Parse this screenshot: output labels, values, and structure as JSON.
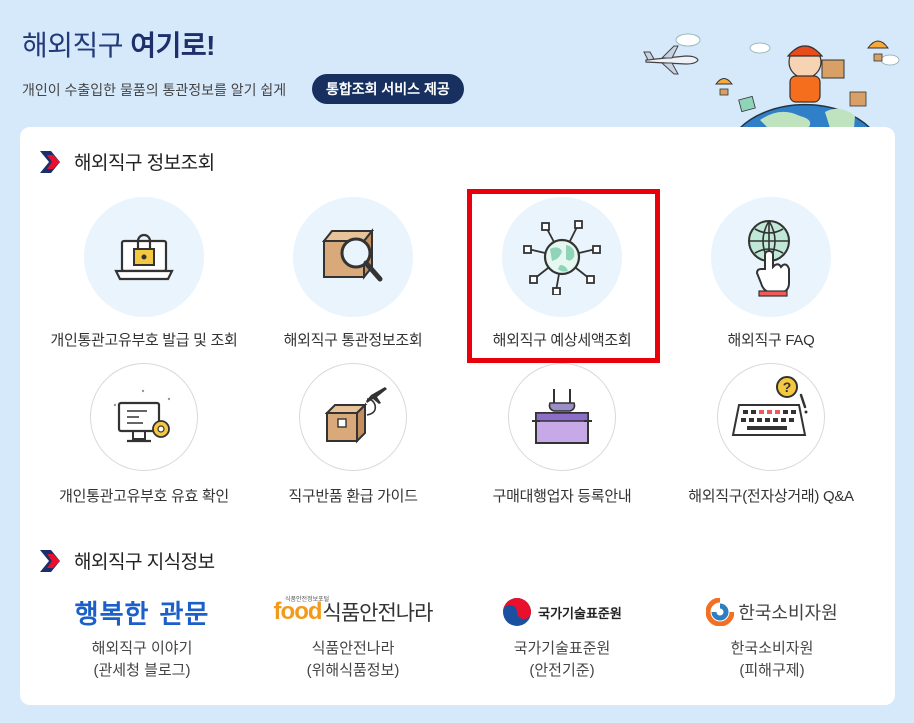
{
  "hero": {
    "title_plain": "해외직구 ",
    "title_bold": "여기로!",
    "subtitle": "개인이 수출입한 물품의 통관정보를 알기 쉽게",
    "badge": "통합조회 서비스 제공"
  },
  "section_info": {
    "title": "해외직구 정보조회"
  },
  "services": [
    {
      "label": "개인통관고유부호 발급 및 조회",
      "icon": "laptop-lock-icon"
    },
    {
      "label": "해외직구 통관정보조회",
      "icon": "box-magnifier-icon"
    },
    {
      "label": "해외직구 예상세액조회",
      "icon": "globe-network-icon"
    },
    {
      "label": "해외직구 FAQ",
      "icon": "globe-hand-icon"
    },
    {
      "label": "개인통관고유부호 유효 확인",
      "icon": "monitor-gear-icon"
    },
    {
      "label": "직구반품 환급 가이드",
      "icon": "box-airplane-icon"
    },
    {
      "label": "구매대행업자 등록안내",
      "icon": "shopping-basket-icon"
    },
    {
      "label": "해외직구(전자상거래) Q&A",
      "icon": "keyboard-question-icon"
    }
  ],
  "section_knowledge": {
    "title": "해외직구 지식정보"
  },
  "knowledge": [
    {
      "logo_text": "행복한 관문",
      "line1": "해외직구 이야기",
      "line2": "(관세청 블로그)"
    },
    {
      "logo_small": "식품안전정보포털",
      "logo_word": "food",
      "logo_text": "식품안전나라",
      "line1": "식품안전나라",
      "line2": "(위해식품정보)"
    },
    {
      "logo_text": "국가기술표준원",
      "line1": "국가기술표준원",
      "line2": "(안전기준)"
    },
    {
      "logo_text": "한국소비자원",
      "line1": "한국소비자원",
      "line2": "(피해구제)"
    }
  ],
  "colors": {
    "navy": "#17305f",
    "highlight": "#e8000b",
    "circle": "#e9f4fd",
    "background": "#d6e9fb"
  }
}
